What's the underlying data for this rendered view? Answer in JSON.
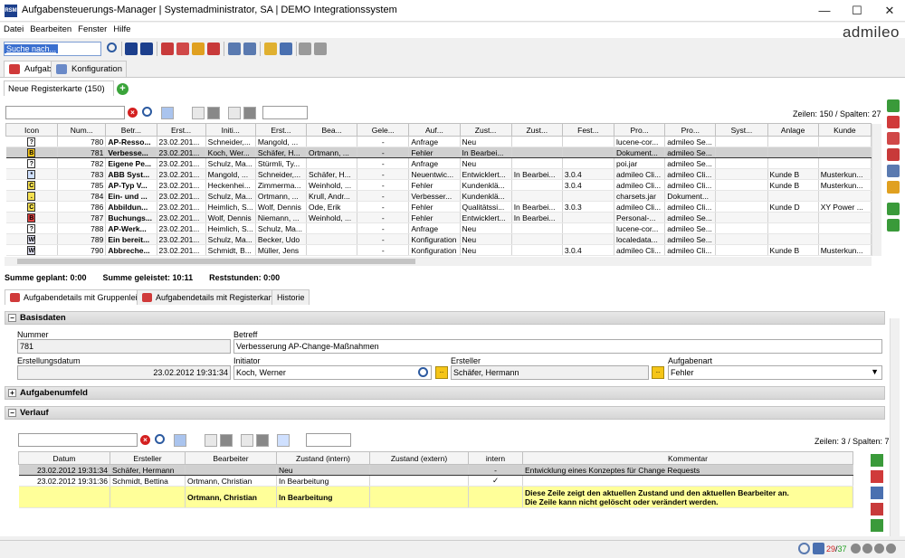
{
  "window": {
    "title": "Aufgabensteuerungs-Manager | Systemadministrator, SA | DEMO Integrationssystem",
    "app_icon": "RSM",
    "logo": "admileo"
  },
  "menu": [
    "Datei",
    "Bearbeiten",
    "Fenster",
    "Hilfe"
  ],
  "toolbar": {
    "search_value": "Suche nach..."
  },
  "module_tabs": [
    "Aufgabe",
    "Konfiguration"
  ],
  "register_tab": "Neue Registerkarte (150)",
  "main_grid": {
    "counter": "Zeilen: 150 / Spalten: 27",
    "columns": [
      "Icon",
      "Num...",
      "Betr...",
      "Erst...",
      "Initi...",
      "Erst...",
      "Bea...",
      "Gele...",
      "Auf...",
      "Zust...",
      "Zust...",
      "Fest...",
      "Pro...",
      "Pro...",
      "Syst...",
      "Anlage",
      "Kunde"
    ],
    "rows": [
      {
        "icon": "?",
        "icolor": "#fff",
        "num": "780",
        "betreff": "AP-Resso...",
        "datum": "23.02.201...",
        "init": "Schneider,...",
        "erst": "Mangold, ...",
        "bea": "",
        "gel": "-",
        "auf": "Anfrage",
        "z1": "Neu",
        "z2": "",
        "fest": "",
        "p1": "lucene-cor...",
        "p2": "admileo Se...",
        "sys": "",
        "anl": "",
        "kun": "",
        "bold": true
      },
      {
        "icon": "B",
        "icolor": "#f5c518",
        "num": "781",
        "betreff": "Verbesse...",
        "datum": "23.02.201...",
        "init": "Koch, Wer...",
        "erst": "Schäfer, H...",
        "bea": "Ortmann, ...",
        "gel": "-",
        "auf": "Fehler",
        "z1": "In Bearbei...",
        "z2": "",
        "fest": "",
        "p1": "Dokument...",
        "p2": "admileo Se...",
        "sys": "",
        "anl": "",
        "kun": "",
        "bold": true,
        "sel": true
      },
      {
        "icon": "?",
        "icolor": "#fff",
        "num": "782",
        "betreff": "Eigene Pe...",
        "datum": "23.02.201...",
        "init": "Schulz, Ma...",
        "erst": "Stürmli, Ty...",
        "bea": "",
        "gel": "-",
        "auf": "Anfrage",
        "z1": "Neu",
        "z2": "",
        "fest": "",
        "p1": "poi.jar",
        "p2": "admileo Se...",
        "sys": "",
        "anl": "",
        "kun": "",
        "bold": true
      },
      {
        "icon": "*",
        "icolor": "#cfe0ff",
        "num": "783",
        "betreff": "ABB Syst...",
        "datum": "23.02.201...",
        "init": "Mangold, ...",
        "erst": "Schneider,...",
        "bea": "Schäfer, H...",
        "gel": "-",
        "auf": "Neuentwic...",
        "z1": "Entwicklert...",
        "z2": "In Bearbei...",
        "fest": "3.0.4",
        "p1": "admileo Cli...",
        "p2": "admileo Cli...",
        "sys": "",
        "anl": "Kunde B",
        "kun": "Musterkun...",
        "bold": true
      },
      {
        "icon": "C",
        "icolor": "#f5e050",
        "num": "785",
        "betreff": "AP-Typ V...",
        "datum": "23.02.201...",
        "init": "Heckenhei...",
        "erst": "Zimmerma...",
        "bea": "Weinhold, ...",
        "gel": "-",
        "auf": "Fehler",
        "z1": "Kundenklä...",
        "z2": "",
        "fest": "3.0.4",
        "p1": "admileo Cli...",
        "p2": "admileo Cli...",
        "sys": "",
        "anl": "Kunde B",
        "kun": "Musterkun...",
        "bold": true
      },
      {
        "icon": ".",
        "icolor": "#f5e050",
        "num": "784",
        "betreff": "Ein- und ...",
        "datum": "23.02.201...",
        "init": "Schulz, Ma...",
        "erst": "Ortmann, ...",
        "bea": "Krull, Andr...",
        "gel": "-",
        "auf": "Verbesser...",
        "z1": "Kundenklä...",
        "z2": "",
        "fest": "",
        "p1": "charsets.jar",
        "p2": "Dokument...",
        "sys": "",
        "anl": "",
        "kun": "",
        "bold": true
      },
      {
        "icon": "C",
        "icolor": "#f5e050",
        "num": "786",
        "betreff": "Abbildun...",
        "datum": "23.02.201...",
        "init": "Heimlich, S...",
        "erst": "Wolf, Dennis",
        "bea": "Ode, Erik",
        "gel": "-",
        "auf": "Fehler",
        "z1": "Qualitätssi...",
        "z2": "In Bearbei...",
        "fest": "3.0.3",
        "p1": "admileo Cli...",
        "p2": "admileo Cli...",
        "sys": "",
        "anl": "Kunde D",
        "kun": "XY Power ...",
        "bold": true
      },
      {
        "icon": "B",
        "icolor": "#e04040",
        "num": "787",
        "betreff": "Buchungs...",
        "datum": "23.02.201...",
        "init": "Wolf, Dennis",
        "erst": "Niemann, ...",
        "bea": "Weinhold, ...",
        "gel": "-",
        "auf": "Fehler",
        "z1": "Entwicklert...",
        "z2": "In Bearbei...",
        "fest": "",
        "p1": "Personal-...",
        "p2": "admileo Se...",
        "sys": "",
        "anl": "",
        "kun": "",
        "bold": true
      },
      {
        "icon": "?",
        "icolor": "#fff",
        "num": "788",
        "betreff": "AP-Werk...",
        "datum": "23.02.201...",
        "init": "Heimlich, S...",
        "erst": "Schulz, Ma...",
        "bea": "",
        "gel": "-",
        "auf": "Anfrage",
        "z1": "Neu",
        "z2": "",
        "fest": "",
        "p1": "lucene-cor...",
        "p2": "admileo Se...",
        "sys": "",
        "anl": "",
        "kun": "",
        "bold": true
      },
      {
        "icon": "W",
        "icolor": "#dde",
        "num": "789",
        "betreff": "Ein bereit...",
        "datum": "23.02.201...",
        "init": "Schulz, Ma...",
        "erst": "Becker, Udo",
        "bea": "",
        "gel": "-",
        "auf": "Konfiguration",
        "z1": "Neu",
        "z2": "",
        "fest": "",
        "p1": "localedata...",
        "p2": "admileo Se...",
        "sys": "",
        "anl": "",
        "kun": "",
        "bold": true
      },
      {
        "icon": "W",
        "icolor": "#dde",
        "num": "790",
        "betreff": "Abbreche...",
        "datum": "23.02.201...",
        "init": "Schmidt, B...",
        "erst": "Müller, Jens",
        "bea": "",
        "gel": "-",
        "auf": "Konfiguration",
        "z1": "Neu",
        "z2": "",
        "fest": "3.0.4",
        "p1": "admileo Cli...",
        "p2": "admileo Cli...",
        "sys": "",
        "anl": "Kunde B",
        "kun": "Musterkun...",
        "bold": true
      }
    ]
  },
  "sums": {
    "geplant": "Summe geplant: 0:00",
    "geleistet": "Summe geleistet: 10:11",
    "rest": "Reststunden: 0:00"
  },
  "detail_tabs": [
    "Aufgabendetails mit Gruppenleiste",
    "Aufgabendetails mit Registerkarten",
    "Historie"
  ],
  "basisdaten": {
    "header": "Basisdaten",
    "nummer_label": "Nummer",
    "nummer": "781",
    "betreff_label": "Betreff",
    "betreff": "Verbesserung AP-Change-Maßnahmen",
    "datum_label": "Erstellungsdatum",
    "datum": "23.02.2012 19:31:34",
    "initiator_label": "Initiator",
    "initiator": "Koch, Werner",
    "ersteller_label": "Ersteller",
    "ersteller": "Schäfer, Hermann",
    "art_label": "Aufgabenart",
    "art": "Fehler"
  },
  "aufgabenumfeld": "Aufgabenumfeld",
  "verlauf": {
    "header": "Verlauf",
    "counter": "Zeilen: 3 / Spalten: 7",
    "columns": [
      "Datum",
      "Ersteller",
      "Bearbeiter",
      "Zustand (intern)",
      "Zustand (extern)",
      "intern",
      "Kommentar"
    ],
    "rows": [
      {
        "datum": "23.02.2012 19:31:34",
        "erst": "Schäfer, Hermann",
        "bearb": "",
        "zi": "Neu",
        "ze": "",
        "intern": "-",
        "komm": "Entwicklung eines Konzeptes für Change Requests"
      },
      {
        "datum": "23.02.2012 19:31:36",
        "erst": "Schmidt, Bettina",
        "bearb": "Ortmann, Christian",
        "zi": "In Bearbeitung",
        "ze": "",
        "intern": "✓",
        "komm": ""
      }
    ],
    "current": {
      "bearb": "Ortmann, Christian",
      "zi": "In Bearbeitung",
      "komm1": "Diese Zeile zeigt den aktuellen Zustand und den aktuellen Bearbeiter an.",
      "komm2": "Die Zeile kann nicht gelöscht oder verändert werden."
    }
  },
  "status": {
    "count_a": "29",
    "count_b": "37"
  }
}
